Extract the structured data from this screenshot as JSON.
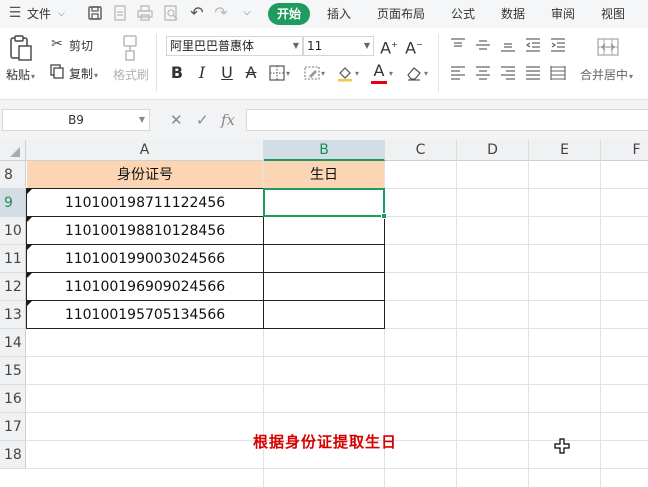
{
  "menubar": {
    "file_label": "文件",
    "tabs": [
      "开始",
      "插入",
      "页面布局",
      "公式",
      "数据",
      "审阅",
      "视图"
    ],
    "active_tab": "开始"
  },
  "ribbon": {
    "paste_label": "粘贴",
    "cut_label": "剪切",
    "copy_label": "复制",
    "format_painter_label": "格式刷",
    "font_name": "阿里巴巴普惠体",
    "font_size": "11",
    "merge_label": "合并居中",
    "font_color": "#e60012"
  },
  "formula_bar": {
    "name_box": "B9",
    "fx_label": "fx",
    "formula": ""
  },
  "sheet": {
    "columns": [
      "A",
      "B",
      "C",
      "D",
      "E",
      "F"
    ],
    "selected_column": "B",
    "rows": [
      "8",
      "9",
      "10",
      "11",
      "12",
      "13",
      "14",
      "15",
      "16",
      "17",
      "18"
    ],
    "selected_row": "9",
    "header": {
      "a": "身份证号",
      "b": "生日"
    },
    "data": [
      {
        "id": "110100198711122456",
        "birthday": ""
      },
      {
        "id": "110100198810128456",
        "birthday": ""
      },
      {
        "id": "110100199003024566",
        "birthday": ""
      },
      {
        "id": "110100196909024566",
        "birthday": ""
      },
      {
        "id": "110100195705134566",
        "birthday": ""
      }
    ],
    "caption": "根据身份证提取生日",
    "header_fill": "#fcd5b4",
    "accent": "#1e9b5e"
  }
}
